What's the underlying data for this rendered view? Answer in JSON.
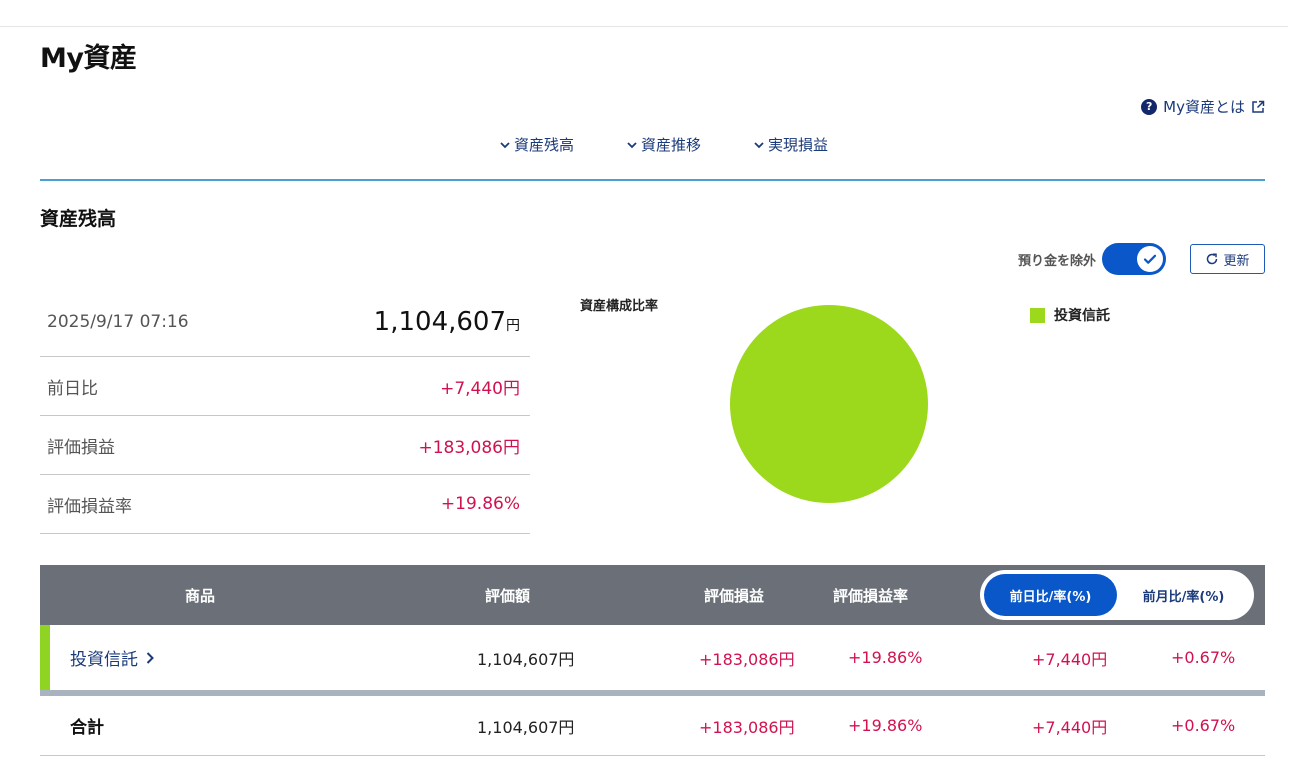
{
  "page": {
    "title": "My資産"
  },
  "help": {
    "label": "My資産とは"
  },
  "anchor_nav": [
    {
      "label": "資産残高"
    },
    {
      "label": "資産推移"
    },
    {
      "label": "実現損益"
    }
  ],
  "section": {
    "title": "資産残高"
  },
  "controls": {
    "exclude_deposit_label": "預り金を除外",
    "exclude_deposit_on": true,
    "refresh_label": "更新"
  },
  "summary": {
    "datetime": "2025/9/17 07:16",
    "total": "1,104,607",
    "total_unit": "円",
    "rows": [
      {
        "label": "前日比",
        "value": "+7,440円"
      },
      {
        "label": "評価損益",
        "value": "+183,086円"
      },
      {
        "label": "評価損益率",
        "value": "+19.86%"
      }
    ]
  },
  "chart_data": {
    "type": "pie",
    "title": "資産構成比率",
    "series": [
      {
        "name": "投資信託",
        "value": 100,
        "color": "#9cd91c"
      }
    ]
  },
  "table": {
    "headers": {
      "product": "商品",
      "valuation": "評価額",
      "pl": "評価損益",
      "pl_rate": "評価損益率"
    },
    "toggle": {
      "day_label": "前日比/率(%)",
      "month_label": "前月比/率(%)",
      "active": "day"
    },
    "rows": [
      {
        "name": "投資信託",
        "valuation": "1,104,607円",
        "pl": "+183,086円",
        "pl_rate": "+19.86%",
        "change": "+7,440円",
        "change_rate": "+0.67%",
        "bar_color": "#8fd422"
      }
    ],
    "total": {
      "label": "合計",
      "valuation": "1,104,607円",
      "pl": "+183,086円",
      "pl_rate": "+19.86%",
      "change": "+7,440円",
      "change_rate": "+0.67%"
    }
  },
  "colors": {
    "accent": "#0a57c9",
    "positive": "#d2124e",
    "header_bg": "#6a6f78",
    "rule": "#4a9fd5"
  }
}
